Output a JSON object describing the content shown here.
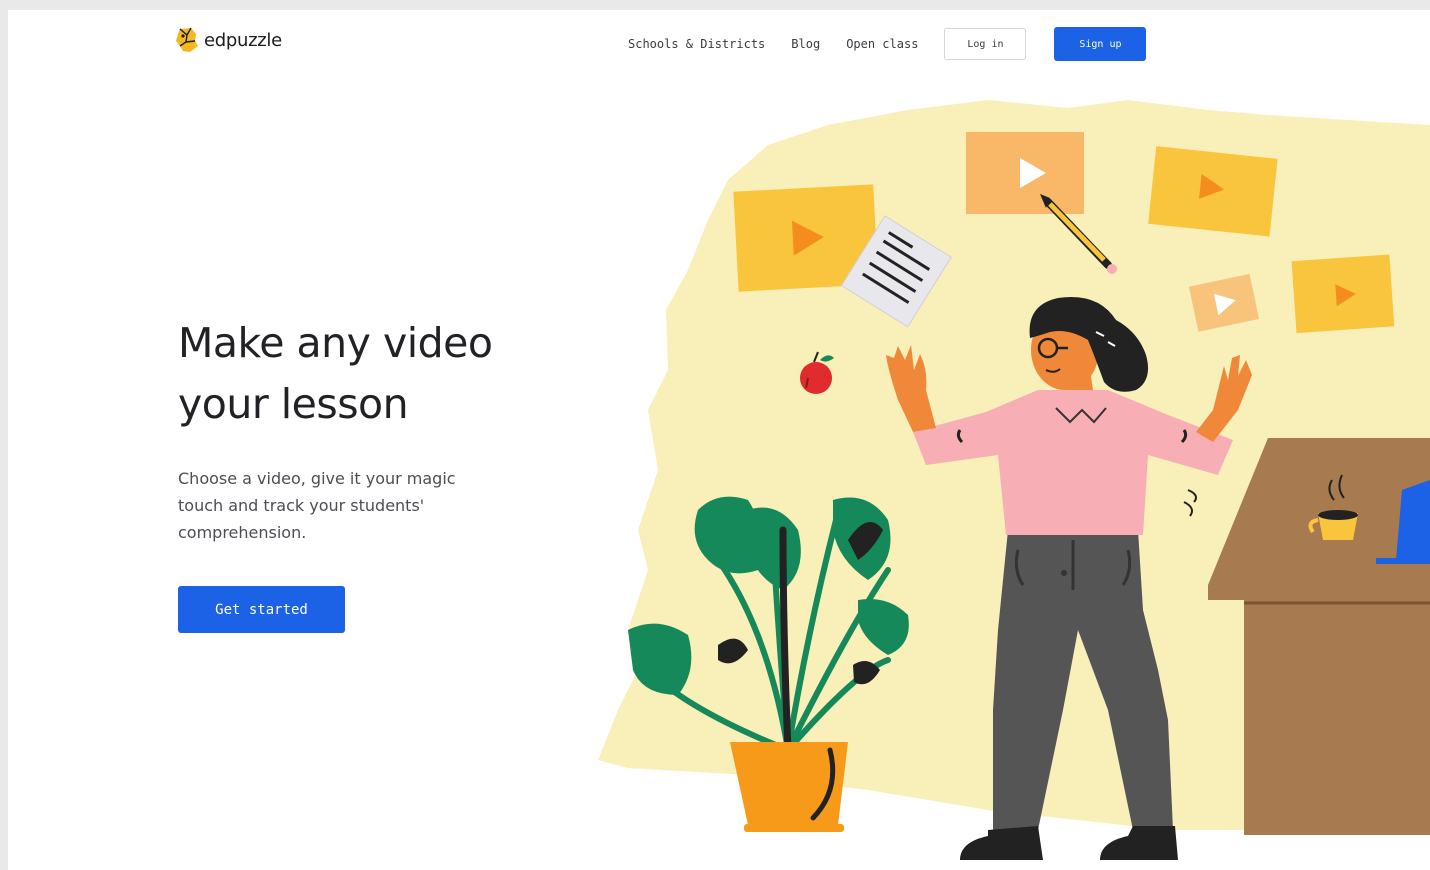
{
  "header": {
    "logo_text": "edpuzzle",
    "nav": [
      {
        "label": "Schools & Districts"
      },
      {
        "label": "Blog"
      },
      {
        "label": "Open class"
      }
    ],
    "login_label": "Log in",
    "signup_label": "Sign up"
  },
  "hero": {
    "title_line1": "Make any video",
    "title_line2": "your lesson",
    "subtitle_line1": "Choose a video, give it your magic",
    "subtitle_line2": "touch and track your students'",
    "subtitle_line3": "comprehension.",
    "cta_label": "Get started"
  },
  "colors": {
    "accent": "#1c62e6",
    "blob": "#f9efb9",
    "video_card": "#f9c53c",
    "shirt": "#f7aeb5",
    "pants": "#555555",
    "plant_pot": "#f79a1a",
    "leaf": "#15895a",
    "desk": "#a87a50"
  },
  "illustration": {
    "icons": [
      "play-icon",
      "notepad-icon",
      "pencil-icon",
      "apple-icon",
      "coffee-cup-icon",
      "laptop-icon"
    ]
  }
}
